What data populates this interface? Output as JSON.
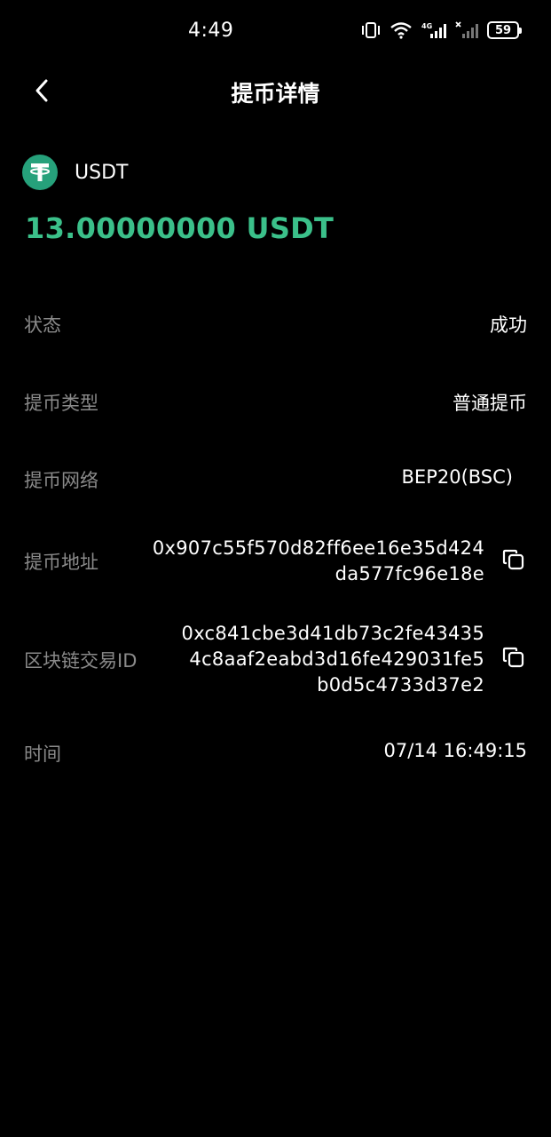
{
  "status_bar": {
    "time": "4:49",
    "battery": "59",
    "icons": [
      "vibrate-icon",
      "wifi-icon",
      "signal-4g-icon",
      "signal-no-service-icon",
      "battery-icon"
    ]
  },
  "header": {
    "back_icon": "chevron-left-icon",
    "title": "提币详情"
  },
  "coin": {
    "icon": "tether-logo",
    "name": "USDT",
    "brand_color": "#26A17B"
  },
  "amount": {
    "text": "13.00000000 USDT",
    "color": "#3BC08A"
  },
  "details": {
    "status": {
      "label": "状态",
      "value": "成功"
    },
    "withdraw_type": {
      "label": "提币类型",
      "value": "普通提币"
    },
    "network": {
      "label": "提币网络",
      "value": "BEP20(BSC)"
    },
    "address": {
      "label": "提币地址",
      "lines": [
        "0x907c55f570d82ff6ee16e35d424",
        "da577fc96e18e"
      ],
      "copy_icon": "copy-icon"
    },
    "tx_id": {
      "label": "区块链交易ID",
      "lines": [
        "0xc841cbe3d41db73c2fe43435",
        "4c8aaf2eabd3d16fe429031fe5",
        "b0d5c4733d37e2"
      ],
      "copy_icon": "copy-icon"
    },
    "time": {
      "label": "时间",
      "value": "07/14 16:49:15"
    }
  },
  "colors": {
    "background": "#000000",
    "label": "#8A8A8A",
    "value": "#FFFFFF"
  }
}
